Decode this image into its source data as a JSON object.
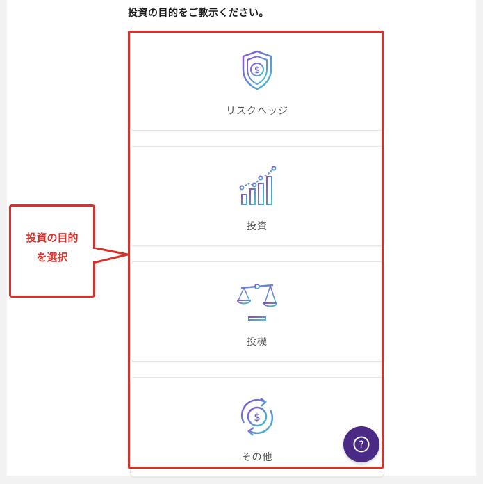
{
  "question": "投資の目的をご教示ください。",
  "options": [
    {
      "label": "リスクヘッジ",
      "icon": "shield-dollar-icon"
    },
    {
      "label": "投資",
      "icon": "growth-chart-icon"
    },
    {
      "label": "投機",
      "icon": "balance-scale-icon"
    },
    {
      "label": "その他",
      "icon": "circular-dollar-icon"
    }
  ],
  "annotation": {
    "line1": "投資の目的",
    "line2": "を選択",
    "color": "#d9302a"
  },
  "help_button": {
    "symbol": "?",
    "color": "#4b2a86"
  },
  "colors": {
    "icon_gradient_start": "#8a4bd6",
    "icon_gradient_end": "#3ec6d2"
  }
}
